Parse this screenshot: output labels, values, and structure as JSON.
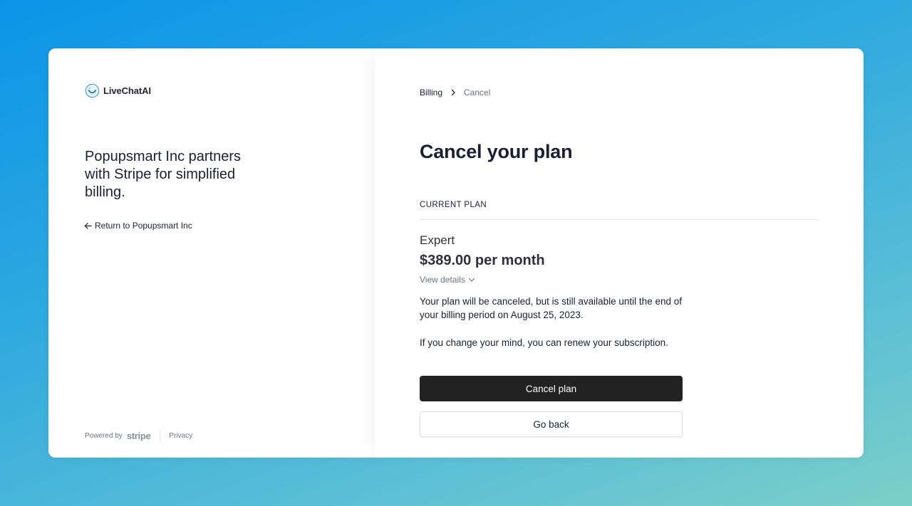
{
  "brand": {
    "logo_text": "LiveChatAI",
    "logo_icon": "livechatai-logo-icon"
  },
  "left": {
    "tagline": "Popupsmart Inc partners with Stripe for simplified billing.",
    "return_link": "Return to Popupsmart Inc",
    "footer": {
      "powered_by": "Powered by",
      "stripe": "stripe",
      "privacy": "Privacy"
    }
  },
  "breadcrumb": {
    "billing": "Billing",
    "current": "Cancel"
  },
  "main": {
    "title": "Cancel your plan",
    "section_label": "CURRENT PLAN",
    "plan_name": "Expert",
    "plan_price": "$389.00 per month",
    "view_details": "View details",
    "message_1": "Your plan will be canceled, but is still available until the end of your billing period on August 25, 2023.",
    "message_2": "If you change your mind, you can renew your subscription.",
    "cancel_button": "Cancel plan",
    "back_button": "Go back"
  },
  "colors": {
    "primary_button": "#222222",
    "text": "#1a1f36",
    "muted": "#6b7280"
  }
}
